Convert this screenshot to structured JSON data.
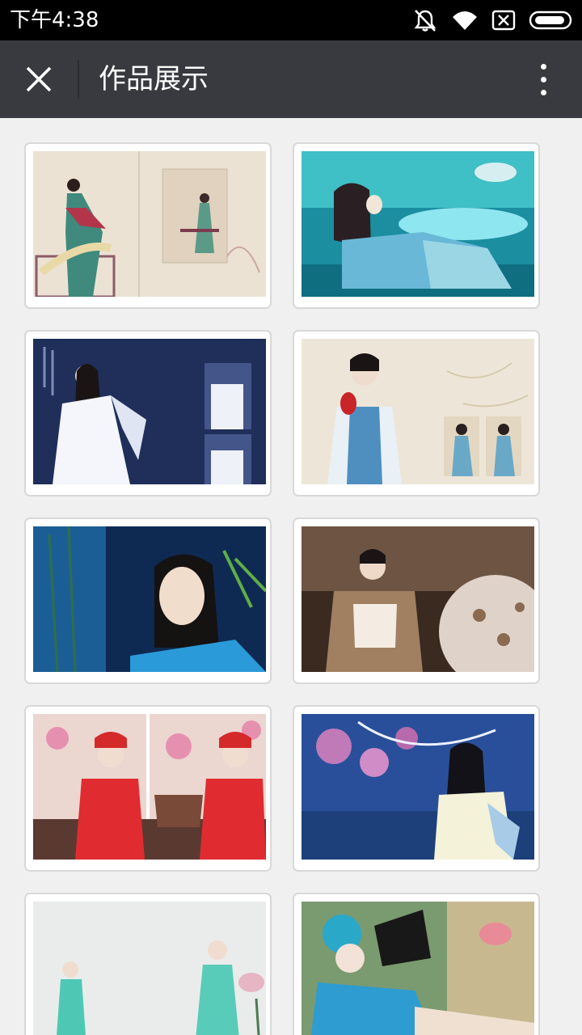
{
  "status_bar": {
    "time": "下午4:38",
    "icons": [
      "mute-icon",
      "wifi-icon",
      "sim-card-none-icon",
      "battery-icon"
    ]
  },
  "toolbar": {
    "title": "作品展示",
    "close_icon": "close-icon",
    "more_icon": "more-vertical-icon"
  },
  "gallery": {
    "items": [
      {
        "id": 1,
        "theme": "cream-ancient-costume"
      },
      {
        "id": 2,
        "theme": "teal-underwater"
      },
      {
        "id": 3,
        "theme": "navy-white-dress"
      },
      {
        "id": 4,
        "theme": "beige-parrot-qipao"
      },
      {
        "id": 5,
        "theme": "blue-bamboo"
      },
      {
        "id": 6,
        "theme": "brown-fan-lace"
      },
      {
        "id": 7,
        "theme": "red-opera"
      },
      {
        "id": 8,
        "theme": "blue-plum-blossom"
      },
      {
        "id": 9,
        "theme": "mint-lotus"
      },
      {
        "id": 10,
        "theme": "green-opera-fan"
      }
    ]
  },
  "colors": {
    "status_bar_bg": "#000000",
    "toolbar_bg": "#393a3f",
    "page_bg": "#f0f0f0",
    "card_border": "#d8d8d8"
  }
}
